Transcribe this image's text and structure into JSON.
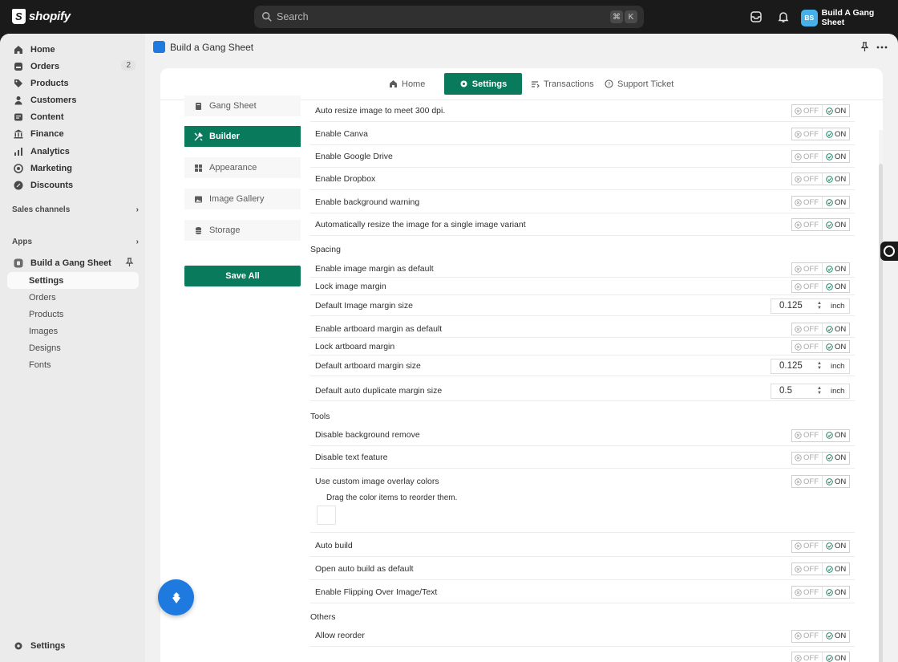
{
  "topbar": {
    "brand": "shopify",
    "search_placeholder": "Search",
    "shortcut_keys": [
      "⌘",
      "K"
    ],
    "store_initials": "BS",
    "store_name": "Build A Gang Sheet"
  },
  "sidebar": {
    "nav": [
      {
        "label": "Home",
        "icon": "home-icon"
      },
      {
        "label": "Orders",
        "icon": "orders-icon",
        "count": "2"
      },
      {
        "label": "Products",
        "icon": "tag-icon"
      },
      {
        "label": "Customers",
        "icon": "person-icon"
      },
      {
        "label": "Content",
        "icon": "content-icon"
      },
      {
        "label": "Finance",
        "icon": "bank-icon"
      },
      {
        "label": "Analytics",
        "icon": "chart-icon"
      },
      {
        "label": "Marketing",
        "icon": "target-icon"
      },
      {
        "label": "Discounts",
        "icon": "discount-icon"
      }
    ],
    "sales_channels": "Sales channels",
    "apps": "Apps",
    "app_name": "Build a Gang Sheet",
    "app_subnav": [
      "Settings",
      "Orders",
      "Products",
      "Images",
      "Designs",
      "Fonts"
    ],
    "settings": "Settings"
  },
  "page": {
    "title": "Build a Gang Sheet"
  },
  "tabs": [
    {
      "label": "Home",
      "icon": "home-icon"
    },
    {
      "label": "Settings",
      "icon": "gear-icon",
      "active": true
    },
    {
      "label": "Transactions",
      "icon": "transactions-icon"
    },
    {
      "label": "Support Ticket",
      "icon": "help-icon"
    }
  ],
  "menu": [
    {
      "label": "Gang Sheet",
      "icon": "document-icon"
    },
    {
      "label": "Builder",
      "icon": "tools-icon",
      "active": true
    },
    {
      "label": "Appearance",
      "icon": "grid-icon"
    },
    {
      "label": "Image Gallery",
      "icon": "image-icon"
    },
    {
      "label": "Storage",
      "icon": "database-icon"
    }
  ],
  "save_all": "Save All",
  "toggle_labels": {
    "off": "OFF",
    "on": "ON"
  },
  "settings": {
    "general": [
      "Auto resize image to meet 300 dpi.",
      "Enable Canva",
      "Enable Google Drive",
      "Enable Dropbox",
      "Enable background warning",
      "Automatically resize the image for a single image variant"
    ],
    "spacing_title": "Spacing",
    "spacing": {
      "image_margin_default": "Enable image margin as default",
      "lock_image_margin": "Lock image margin",
      "default_image_margin_size": "Default Image margin size",
      "image_margin_value": "0.125",
      "artboard_margin_default": "Enable artboard margin as default",
      "lock_artboard_margin": "Lock artboard margin",
      "default_artboard_margin_size": "Default artboard margin size",
      "artboard_margin_value": "0.125",
      "default_dup_margin_size": "Default auto duplicate margin size",
      "dup_margin_value": "0.5",
      "unit": "inch"
    },
    "tools_title": "Tools",
    "tools": {
      "disable_bg_remove": "Disable background remove",
      "disable_text": "Disable text feature",
      "custom_overlay": "Use custom image overlay colors",
      "drag_hint": "Drag the color items to reorder them.",
      "auto_build": "Auto build",
      "open_auto_build": "Open auto build as default",
      "flipping": "Enable Flipping Over Image/Text"
    },
    "others_title": "Others",
    "others": {
      "allow_reorder": "Allow reorder"
    }
  },
  "colors": {
    "accent": "#0a7a5c",
    "topbar": "#1a1a1a",
    "app_icon": "#1f7ae0"
  }
}
